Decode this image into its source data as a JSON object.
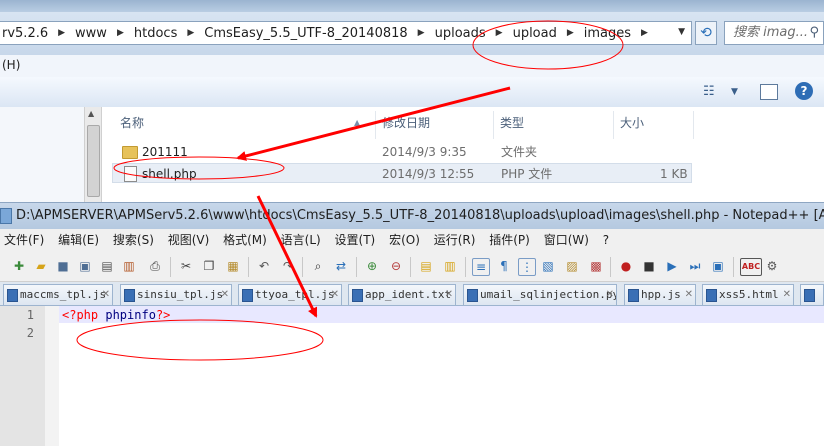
{
  "explorer": {
    "breadcrumbs": [
      "rv5.2.6",
      "www",
      "htdocs",
      "CmsEasy_5.5_UTF-8_20140818",
      "uploads",
      "upload",
      "images"
    ],
    "search_placeholder": "搜索 imag...",
    "menu_fragment": "(H)",
    "columns": {
      "name": "名称",
      "modified": "修改日期",
      "type": "类型",
      "size": "大小"
    },
    "files": [
      {
        "name": "201111",
        "modified": "2014/9/3 9:35",
        "type": "文件夹",
        "size": "",
        "icon": "folder-icon"
      },
      {
        "name": "shell.php",
        "modified": "2014/9/3 12:55",
        "type": "PHP 文件",
        "size": "1 KB",
        "icon": "php-file-icon"
      }
    ]
  },
  "notepad": {
    "title": "D:\\APMSERVER\\APMServ5.2.6\\www\\htdocs\\CmsEasy_5.5_UTF-8_20140818\\uploads\\upload\\images\\shell.php - Notepad++ [Administrator]",
    "menu": [
      "文件(F)",
      "编辑(E)",
      "搜索(S)",
      "视图(V)",
      "格式(M)",
      "语言(L)",
      "设置(T)",
      "宏(O)",
      "运行(R)",
      "插件(P)",
      "窗口(W)",
      "?"
    ],
    "tabs": [
      "maccms_tpl.js",
      "sinsiu_tpl.js",
      "ttyoa_tpl.js",
      "app_ident.txt",
      "umail_sqlinjection.py",
      "hpp.js",
      "xss5.html"
    ],
    "line_numbers": [
      "1",
      "2"
    ],
    "code": {
      "open_tag": "<?php",
      "func": "phpinfo",
      "close_tag": "?>"
    }
  },
  "colors": {
    "annotation_red": "#ff0000",
    "line_highlight": "#e8e8ff",
    "php_tag": "#ff0000"
  }
}
